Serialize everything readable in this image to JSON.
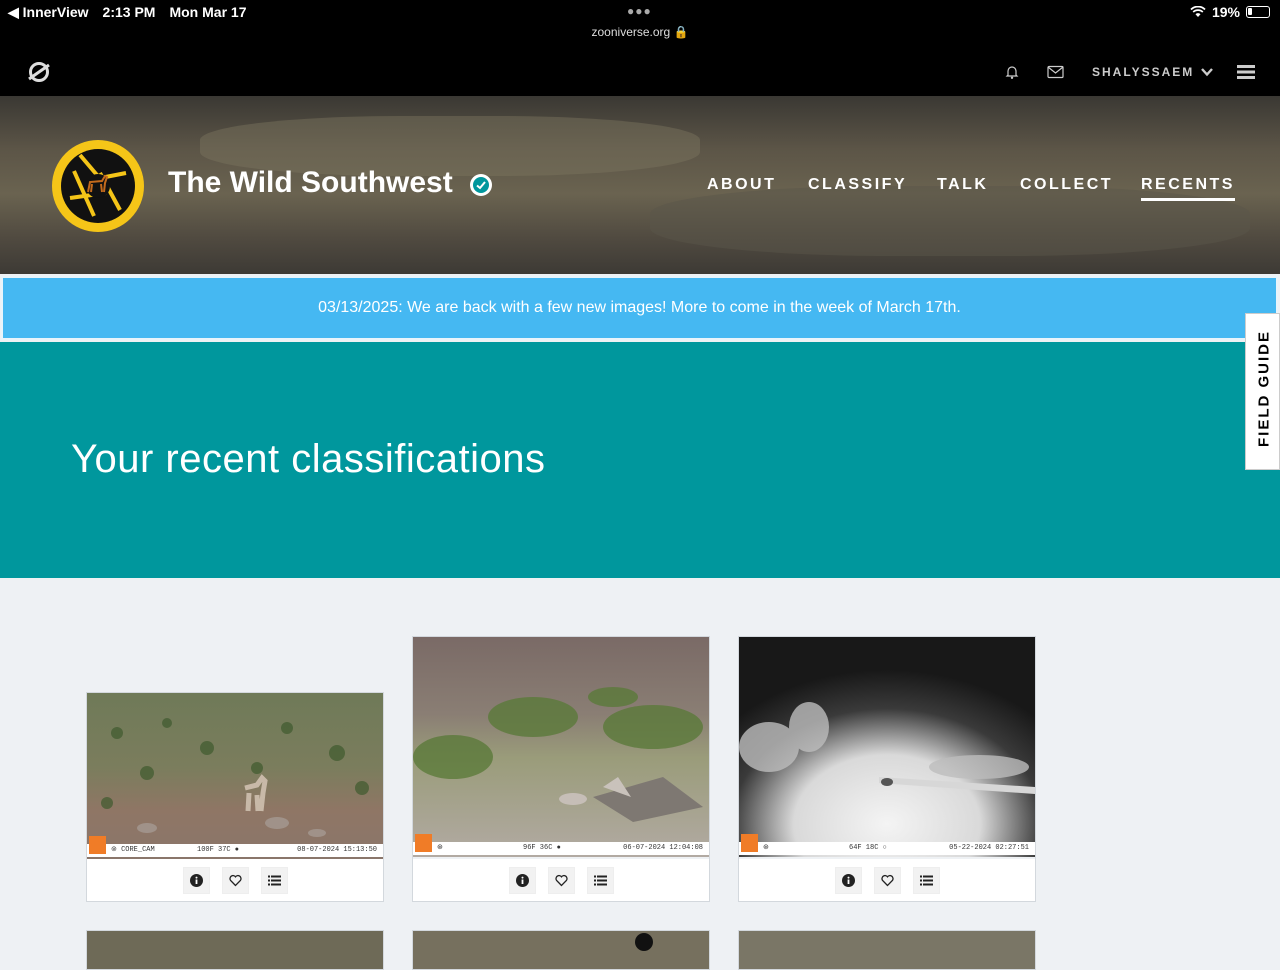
{
  "status_bar": {
    "back_app": "◀ InnerView",
    "time": "2:13 PM",
    "date": "Mon Mar 17",
    "url": "zooniverse.org 🔒",
    "battery": "19%"
  },
  "zooniverse_bar": {
    "username": "SHALYSSAEM"
  },
  "project": {
    "title": "The Wild Southwest",
    "nav": [
      {
        "label": "ABOUT"
      },
      {
        "label": "CLASSIFY"
      },
      {
        "label": "TALK"
      },
      {
        "label": "COLLECT"
      },
      {
        "label": "RECENTS",
        "active": true
      }
    ]
  },
  "announcement": "03/13/2025: We are back with a few new images! More to come in the week of March 17th.",
  "hero": {
    "heading": "Your recent classifications"
  },
  "field_guide": "FIELD GUIDE",
  "cards": [
    {
      "stamp_left": "⊚  CORE_CAM",
      "stamp_mid": "100F  37C   ●",
      "stamp_right": "08-07-2024  15:13:50"
    },
    {
      "stamp_left": "⊛",
      "stamp_mid": "96F  36C   ●",
      "stamp_right": "06-07-2024  12:04:08"
    },
    {
      "stamp_left": "⊛",
      "stamp_mid": "64F  18C   ○",
      "stamp_right": "05-22-2024  02:27:51"
    }
  ],
  "colors": {
    "announce_bg": "#45b8f2",
    "hero_bg": "#00979d",
    "logo_yellow": "#f5c518",
    "verify_teal": "#00979d"
  },
  "icons": [
    "zooniverse-logo-icon",
    "bell-icon",
    "mail-icon",
    "chevron-down-icon",
    "hamburger-menu-icon",
    "verified-check-icon",
    "info-icon",
    "heart-icon",
    "list-icon"
  ]
}
